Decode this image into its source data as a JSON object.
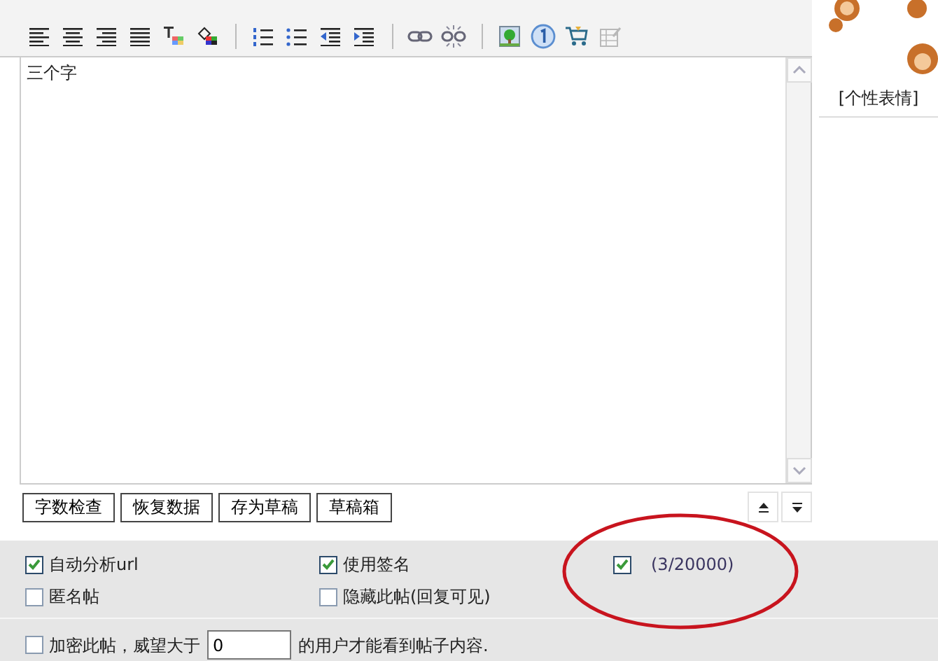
{
  "toolbar": [
    {
      "kind": "alignleft",
      "disabled": false
    },
    {
      "kind": "aligncenter",
      "disabled": false
    },
    {
      "kind": "alignright",
      "disabled": false
    },
    {
      "kind": "justify",
      "disabled": false
    },
    {
      "kind": "forecolor",
      "disabled": false
    },
    {
      "kind": "backcolor",
      "disabled": false
    },
    {
      "kind": "separator"
    },
    {
      "kind": "orderedlist",
      "disabled": false
    },
    {
      "kind": "bulletlist",
      "disabled": false
    },
    {
      "kind": "outdent",
      "disabled": false
    },
    {
      "kind": "indent",
      "disabled": false
    },
    {
      "kind": "separator"
    },
    {
      "kind": "link",
      "disabled": false
    },
    {
      "kind": "unlink",
      "disabled": false
    },
    {
      "kind": "separator"
    },
    {
      "kind": "image",
      "disabled": false
    },
    {
      "kind": "number",
      "disabled": false
    },
    {
      "kind": "cart",
      "disabled": false
    },
    {
      "kind": "edit",
      "disabled": true
    }
  ],
  "editor": {
    "value": "三个字"
  },
  "emoticons": {
    "caption": "[个性表情]"
  },
  "buttons": [
    "字数检查",
    "恢复数据",
    "存为草稿",
    "草稿箱"
  ],
  "options": [
    {
      "label": "自动分析url",
      "checked": true
    },
    {
      "label": "使用签名",
      "checked": true
    },
    {
      "label": "匿名帖",
      "checked": false
    },
    {
      "label": "隐藏此帖(回复可见)",
      "checked": false
    }
  ],
  "counter": {
    "checked": true,
    "text": "(3/20000)"
  },
  "encrypt": {
    "checked": false,
    "before": "加密此帖，威望大于",
    "value": "0",
    "after": "的用户才能看到帖子内容."
  }
}
